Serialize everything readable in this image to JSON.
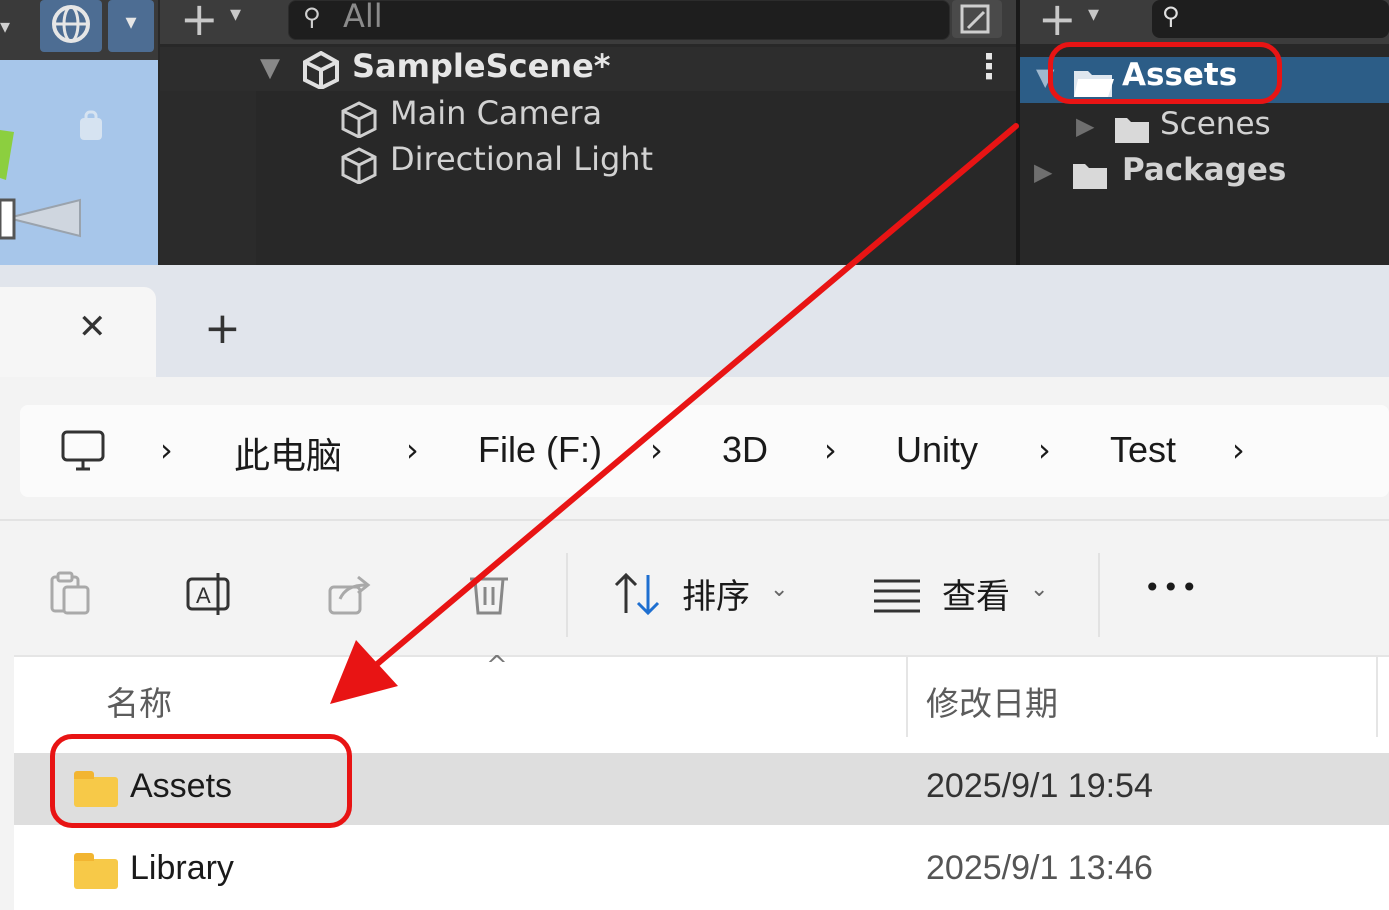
{
  "unity": {
    "hierarchy": {
      "search_placeholder": "All",
      "scene_name": "SampleScene*",
      "items": [
        "Main Camera",
        "Directional Light"
      ],
      "add_icon": "plus-icon",
      "menu_icon": "kebab-icon"
    },
    "project": {
      "items": [
        {
          "label": "Assets"
        },
        {
          "label": "Scenes"
        },
        {
          "label": "Packages"
        }
      ]
    }
  },
  "explorer": {
    "tab": {
      "close_symbol": "✕",
      "new_tab_symbol": "+"
    },
    "breadcrumb": [
      "此电脑",
      "File (F:)",
      "3D",
      "Unity",
      "Test"
    ],
    "toolbar": {
      "sort_label": "排序",
      "view_label": "查看",
      "more_label": "•••"
    },
    "columns": {
      "name": "名称",
      "date": "修改日期"
    },
    "files": [
      {
        "name": "Assets",
        "date": "2025/9/1 19:54"
      },
      {
        "name": "Library",
        "date": "2025/9/1 13:46"
      }
    ]
  },
  "colors": {
    "annotation": "#e81414",
    "unity_selection": "#2c5d87",
    "folder": "#f7c948"
  }
}
